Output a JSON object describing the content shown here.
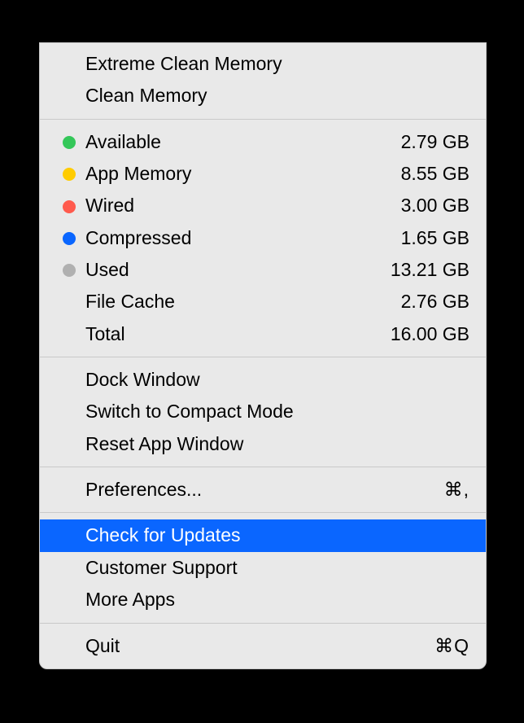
{
  "section1": [
    {
      "label": "Extreme Clean Memory"
    },
    {
      "label": "Clean Memory"
    }
  ],
  "stats": [
    {
      "label": "Available",
      "value": "2.79 GB",
      "dotStyle": "background:#34c759"
    },
    {
      "label": "App Memory",
      "value": "8.55 GB",
      "dotStyle": "background:#ffcc00"
    },
    {
      "label": "Wired",
      "value": "3.00 GB",
      "dotStyle": "background:#ff5a4d"
    },
    {
      "label": "Compressed",
      "value": "1.65 GB",
      "dotStyle": "background:#0a66ff"
    },
    {
      "label": "Used",
      "value": "13.21 GB",
      "dotStyle": "background:#b0b0b0"
    },
    {
      "label": "File Cache",
      "value": "2.76 GB"
    },
    {
      "label": "Total",
      "value": "16.00 GB"
    }
  ],
  "windowSection": [
    {
      "label": "Dock Window"
    },
    {
      "label": "Switch to Compact Mode"
    },
    {
      "label": "Reset App Window"
    }
  ],
  "prefs": {
    "label": "Preferences...",
    "shortcut": "⌘,"
  },
  "support": [
    {
      "label": "Check for Updates"
    },
    {
      "label": "Customer Support"
    },
    {
      "label": "More Apps"
    }
  ],
  "quit": {
    "label": "Quit",
    "shortcut": "⌘Q"
  }
}
